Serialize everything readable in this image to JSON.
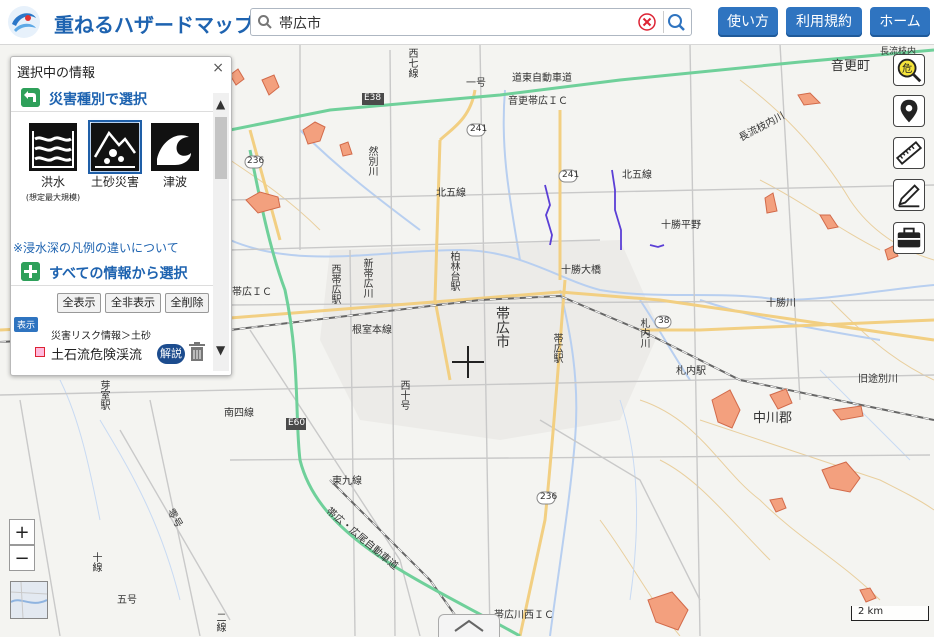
{
  "header": {
    "app_title": "重ねるハザードマップ",
    "search_value": "帯広市",
    "buttons": {
      "usage": "使い方",
      "terms": "利用規約",
      "home": "ホーム"
    }
  },
  "panel": {
    "title": "選択中の情報",
    "close": "×",
    "section_by_type": "災害種別で選択",
    "hazards": [
      {
        "label": "洪水",
        "note": "(想定最大規模)"
      },
      {
        "label": "土砂災害"
      },
      {
        "label": "津波"
      }
    ],
    "legend_link": "※浸水深の凡例の違いについて",
    "section_all": "すべての情報から選択",
    "buttons": {
      "show_all": "全表示",
      "hide_all": "全非表示",
      "delete_all": "全削除"
    },
    "display_tag": "表示",
    "risk_path": "災害リスク情報＞土砂",
    "risk_name": "土石流危険渓流",
    "explain": "解説"
  },
  "map": {
    "labels": {
      "otofuke": "音更町",
      "nakasatsunai": "中川郡",
      "obihiro_city": "帯広市",
      "dotou": "道東自動車道",
      "otofuke_ic": "音更帯広ＩＣ",
      "obihiro_ic": "帯広ＩＣ",
      "obihiro_jct_ic": "帯広川西ＩＣ",
      "kita5": "北五線",
      "kita5b": "北五線",
      "tokachi_heiya": "十勝平野",
      "tokachi_ohashi": "十勝大橋",
      "tokachigawa": "十勝川",
      "nemuro": "根室本線",
      "nishi_obihiro": "西帯広駅",
      "kashiwabayashi": "柏林台駅",
      "obihiro_station": "帯広駅",
      "satsunai_station": "札内駅",
      "memuro": "芽室駅",
      "minami4": "南四線",
      "higashi9": "東九線",
      "nishi10": "西十号",
      "nishi7": "西七線",
      "ichigo": "一号",
      "kyuotobetsu": "旧途別川",
      "nagaregawa": "長流枝内川",
      "zenzen": "然別川",
      "satsunai_river": "札内川",
      "shinobihiro": "新帯広川",
      "reigou": "零号",
      "jugo": "十線",
      "go": "五号",
      "nigo": "二線",
      "hiroo": "帯広・広尾自動車道",
      "route_38": "38",
      "route_236": "236",
      "route_241": "241",
      "e38": "E38",
      "e60": "E60",
      "nagaregawa_top": "長流枝内"
    }
  },
  "zoom": {
    "in": "+",
    "out": "−"
  },
  "scale": "2 km"
}
